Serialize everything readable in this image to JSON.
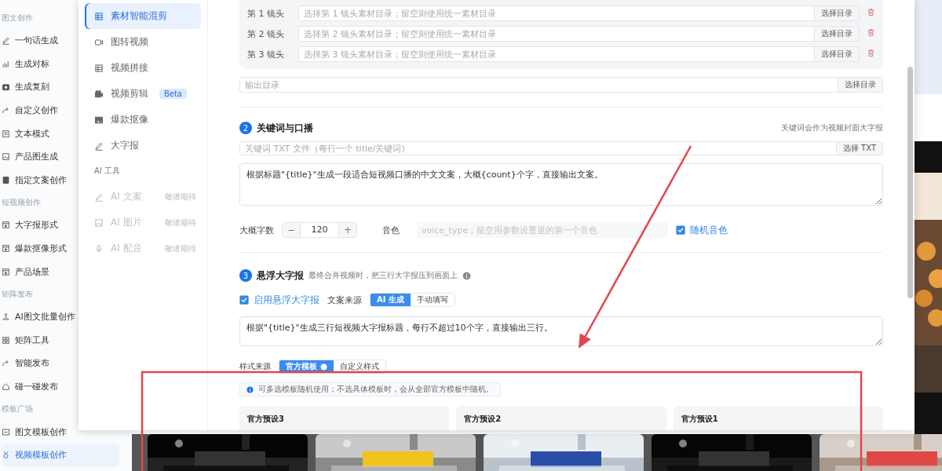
{
  "app_sidebar": {
    "sections": [
      {
        "title": "图文创作",
        "items": [
          {
            "label": "一句话生成",
            "selected": false
          },
          {
            "label": "生成对标",
            "selected": false
          },
          {
            "label": "生成复刻",
            "selected": false
          },
          {
            "label": "自定义创作",
            "selected": false
          },
          {
            "label": "文本模式",
            "selected": false
          },
          {
            "label": "产品图生成",
            "selected": false
          },
          {
            "label": "指定文案创作",
            "selected": false
          }
        ]
      },
      {
        "title": "短视频创作",
        "items": [
          {
            "label": "大字报形式",
            "selected": false
          },
          {
            "label": "爆款抠像形式",
            "selected": false
          },
          {
            "label": "产品场景",
            "selected": false
          }
        ]
      },
      {
        "title": "矩阵发布",
        "items": [
          {
            "label": "AI图文批量创作",
            "selected": false
          },
          {
            "label": "矩阵工具",
            "selected": false
          },
          {
            "label": "智能发布",
            "selected": false
          },
          {
            "label": "碰一碰发布",
            "selected": false
          }
        ]
      },
      {
        "title": "模板广场",
        "items": [
          {
            "label": "图文模板创作",
            "selected": false
          },
          {
            "label": "视频模板创作",
            "selected": true
          }
        ]
      }
    ]
  },
  "dialog": {
    "nav": [
      {
        "label": "素材智能混剪",
        "selected": true
      },
      {
        "label": "图转视频",
        "selected": false
      },
      {
        "label": "视频拼接",
        "selected": false
      },
      {
        "label": "视频剪辑",
        "selected": false,
        "badge": "Beta"
      },
      {
        "label": "爆款抠像",
        "selected": false
      },
      {
        "label": "大字报",
        "selected": false
      }
    ],
    "tools_title": "AI 工具",
    "tools": [
      {
        "label": "AI 文案",
        "note": "敬请期待",
        "disabled": true
      },
      {
        "label": "AI 图片",
        "note": "敬请期待",
        "disabled": true
      },
      {
        "label": "AI 配音",
        "note": "敬请期待",
        "disabled": true
      }
    ],
    "shots": [
      {
        "label": "第 1 镜头",
        "placeholder": "选择第 1 镜头素材目录；留空则使用统一素材目录",
        "button": "选择目录"
      },
      {
        "label": "第 2 镜头",
        "placeholder": "选择第 2 镜头素材目录；留空则使用统一素材目录",
        "button": "选择目录"
      },
      {
        "label": "第 3 镜头",
        "placeholder": "选择第 3 镜头素材目录；留空则使用统一素材目录",
        "button": "选择目录"
      }
    ],
    "output_dir": {
      "placeholder": "输出目录",
      "button": "选择目录"
    },
    "keyword_section": {
      "number": "2",
      "title": "关键词与口播",
      "hint": "关键词会作为视频封面大字报",
      "file_field": {
        "placeholder": "关键词 TXT 文件（每行一个 title/关键词)",
        "button": "选择 TXT"
      },
      "prompt": "根据标题\"{title}\"生成一段适合短视频口播的中文文案，大概{count}个字，直接输出文案。",
      "word_count": {
        "label": "大概字数",
        "minus": "−",
        "value": "120",
        "plus": "+"
      },
      "voice": {
        "label": "音色",
        "placeholder": "voice_type；留空用参数设置里的第一个音色"
      },
      "random_voice": {
        "label": "随机音色",
        "checked": true
      }
    },
    "overlay_section": {
      "number": "3",
      "title": "悬浮大字报",
      "hint": "最终合并视频时，把三行大字报压到画面上",
      "enable": {
        "label": "启用悬浮大字报",
        "checked": true
      },
      "source": {
        "label": "文案来源",
        "options": [
          {
            "label": "AI 生成",
            "selected": true
          },
          {
            "label": "手动填写",
            "selected": false
          }
        ]
      },
      "prompt": "根据\"{title}\"生成三行短视频大字报标题，每行不超过10个字，直接输出三行。",
      "style_source": {
        "label": "样式来源",
        "options": [
          {
            "label": "官方模板",
            "selected": true
          },
          {
            "label": "自定义样式",
            "selected": false
          }
        ]
      },
      "notice": "可多选模板随机使用；不选具体模板时，会从全部官方模板中随机。",
      "presets": [
        {
          "title": "官方预设3"
        },
        {
          "title": "官方预设2"
        },
        {
          "title": "官方预设1"
        }
      ]
    }
  },
  "annotations": [
    {
      "kind": "box"
    },
    {
      "kind": "arrow"
    }
  ]
}
